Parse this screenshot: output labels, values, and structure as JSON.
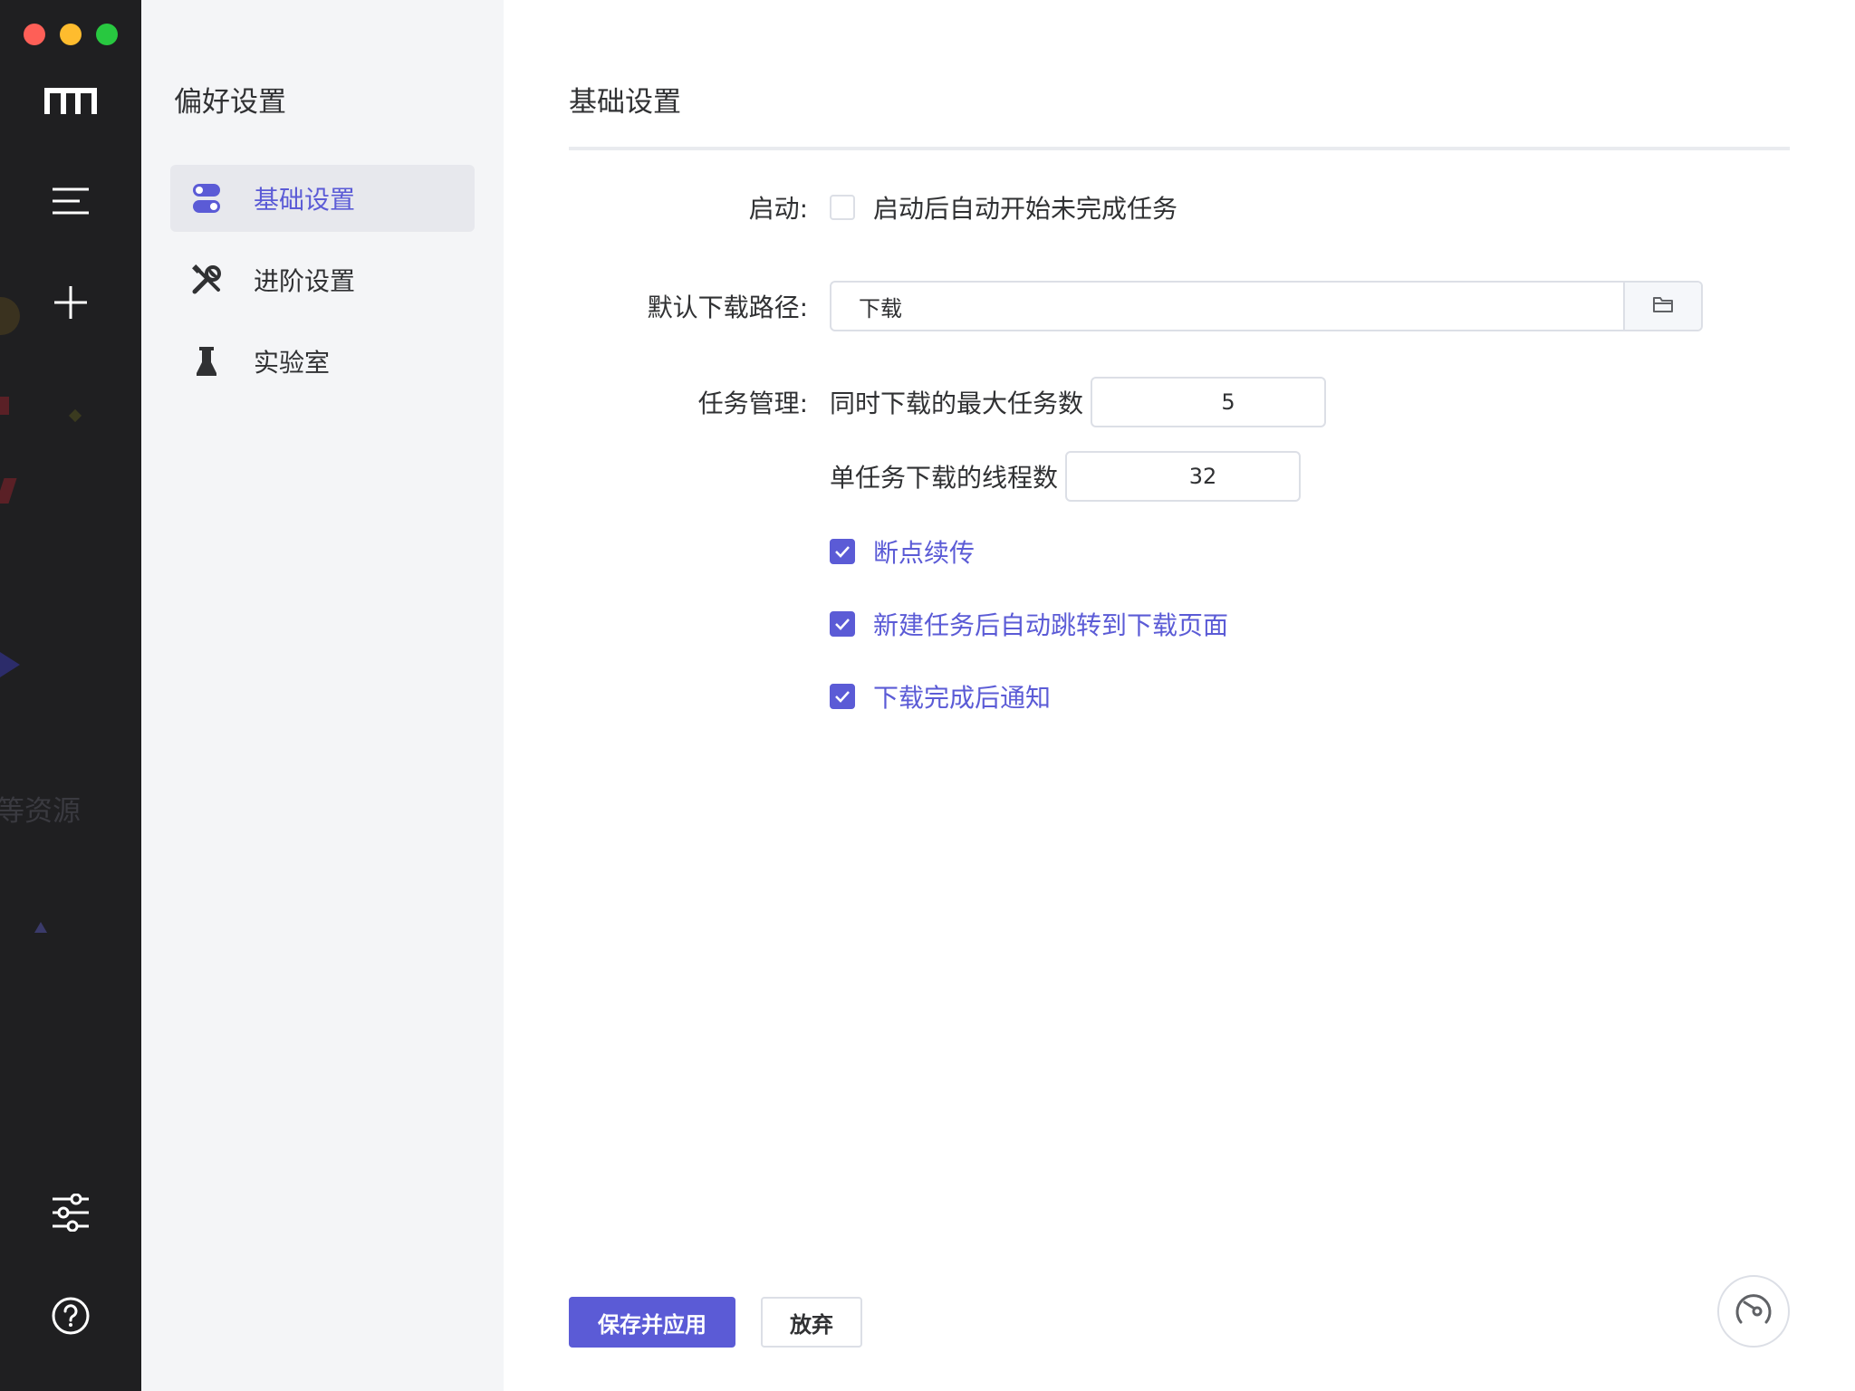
{
  "window": {
    "traffic_lights": [
      "close",
      "minimize",
      "maximize"
    ]
  },
  "rail": {
    "items": [
      {
        "name": "logo",
        "icon": "motrix-logo-icon"
      },
      {
        "name": "menu",
        "icon": "menu-icon"
      },
      {
        "name": "add",
        "icon": "plus-icon"
      },
      {
        "name": "preferences",
        "icon": "sliders-icon"
      },
      {
        "name": "help",
        "icon": "help-icon"
      }
    ],
    "background_text": "等资源"
  },
  "side": {
    "title": "偏好设置",
    "nav": [
      {
        "label": "基础设置",
        "icon": "toggle-icon",
        "active": true
      },
      {
        "label": "进阶设置",
        "icon": "tools-icon",
        "active": false
      },
      {
        "label": "实验室",
        "icon": "flask-icon",
        "active": false
      }
    ]
  },
  "main": {
    "title": "基础设置",
    "startup": {
      "label": "启动:",
      "auto_resume": {
        "label": "启动后自动开始未完成任务",
        "checked": false
      }
    },
    "download_path": {
      "label": "默认下载路径:",
      "value": "下载",
      "browse_icon": "folder-icon"
    },
    "task_management": {
      "label": "任务管理:",
      "max_concurrent": {
        "label": "同时下载的最大任务数",
        "value": "5"
      },
      "split": {
        "label": "单任务下载的线程数",
        "value": "32"
      },
      "options": [
        {
          "label": "断点续传",
          "checked": true
        },
        {
          "label": "新建任务后自动跳转到下载页面",
          "checked": true
        },
        {
          "label": "下载完成后通知",
          "checked": true
        }
      ]
    },
    "footer": {
      "save_label": "保存并应用",
      "discard_label": "放弃",
      "speedometer_icon": "speedometer-icon"
    }
  },
  "colors": {
    "accent": "#5b5bd6",
    "rail_bg": "#1f1f21",
    "side_bg": "#f4f5f7",
    "border": "#dcdfe6"
  }
}
